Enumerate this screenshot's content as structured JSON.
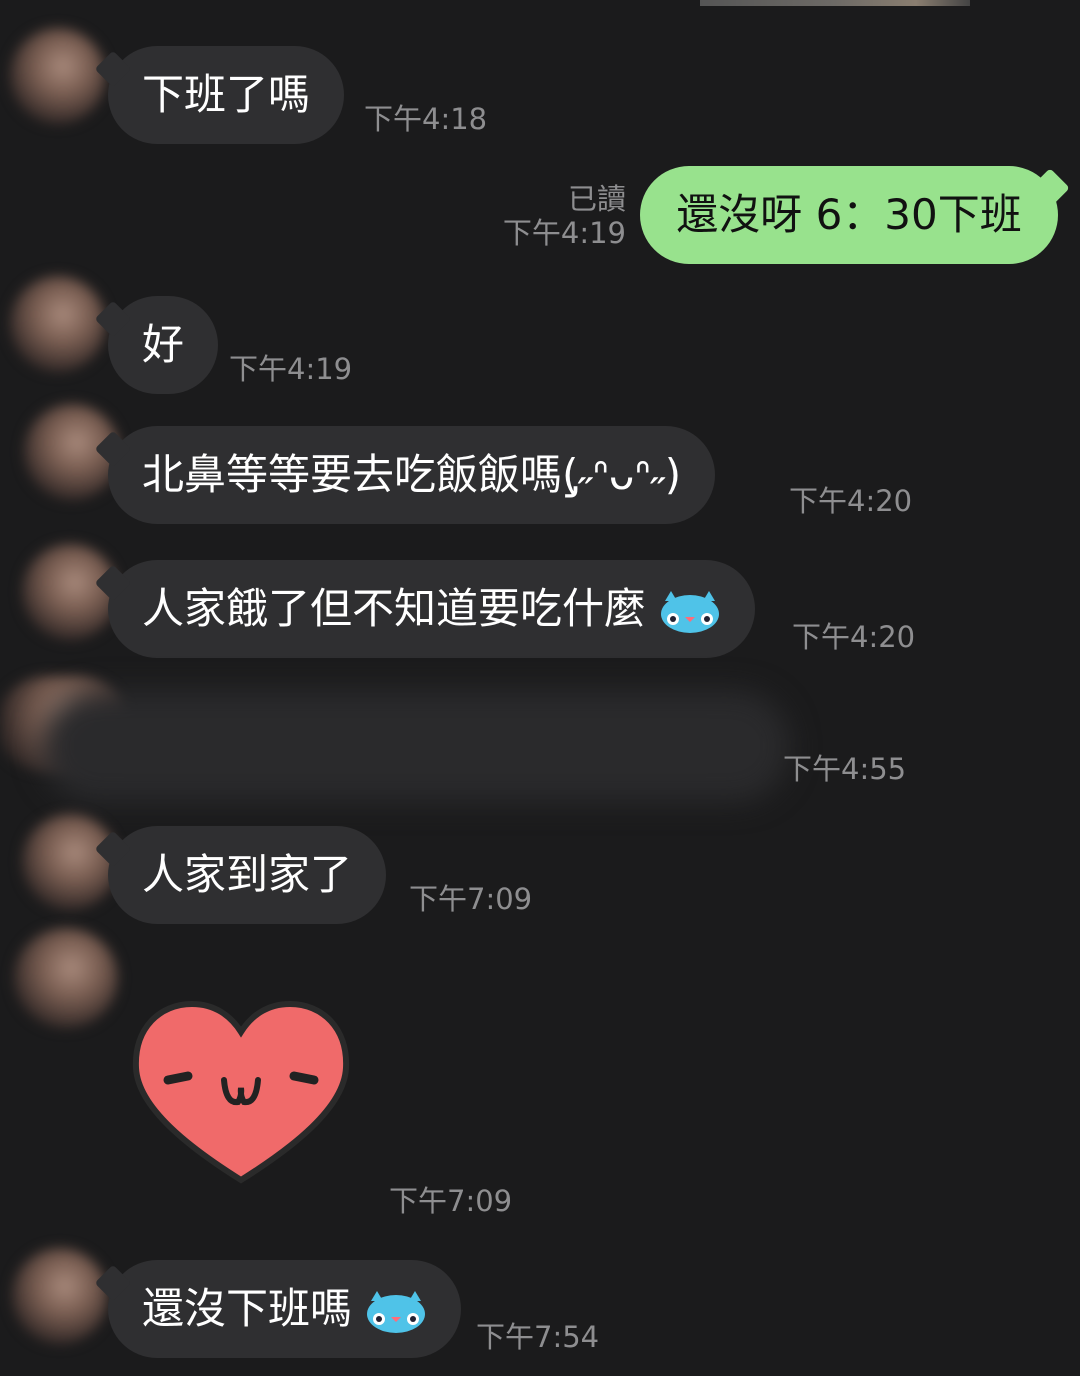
{
  "messages": [
    {
      "text": "下班了嗎",
      "time": "下午4:18"
    },
    {
      "text": "還沒呀 6：30下班",
      "time": "下午4:19",
      "read": "已讀"
    },
    {
      "text": "好",
      "time": "下午4:19"
    },
    {
      "text": "北鼻等等要去吃飯飯嗎(̡˶ᐢᴗᐢ˶)",
      "time": "下午4:20"
    },
    {
      "text": "人家餓了但不知道要吃什麼",
      "time": "下午4:20",
      "emoji": "crying-cat-emoji"
    },
    {
      "time": "下午4:55"
    },
    {
      "text": "人家到家了",
      "time": "下午7:09"
    },
    {
      "time": "下午7:09",
      "sticker": "smiling-heart-sticker"
    },
    {
      "text": "還沒下班嗎",
      "time": "下午7:54",
      "emoji": "crying-cat-emoji"
    }
  ],
  "colors": {
    "background": "#1b1b1c",
    "incoming_bubble": "#2f2f31",
    "outgoing_bubble": "#98e28d",
    "timestamp": "#8e8e90"
  }
}
